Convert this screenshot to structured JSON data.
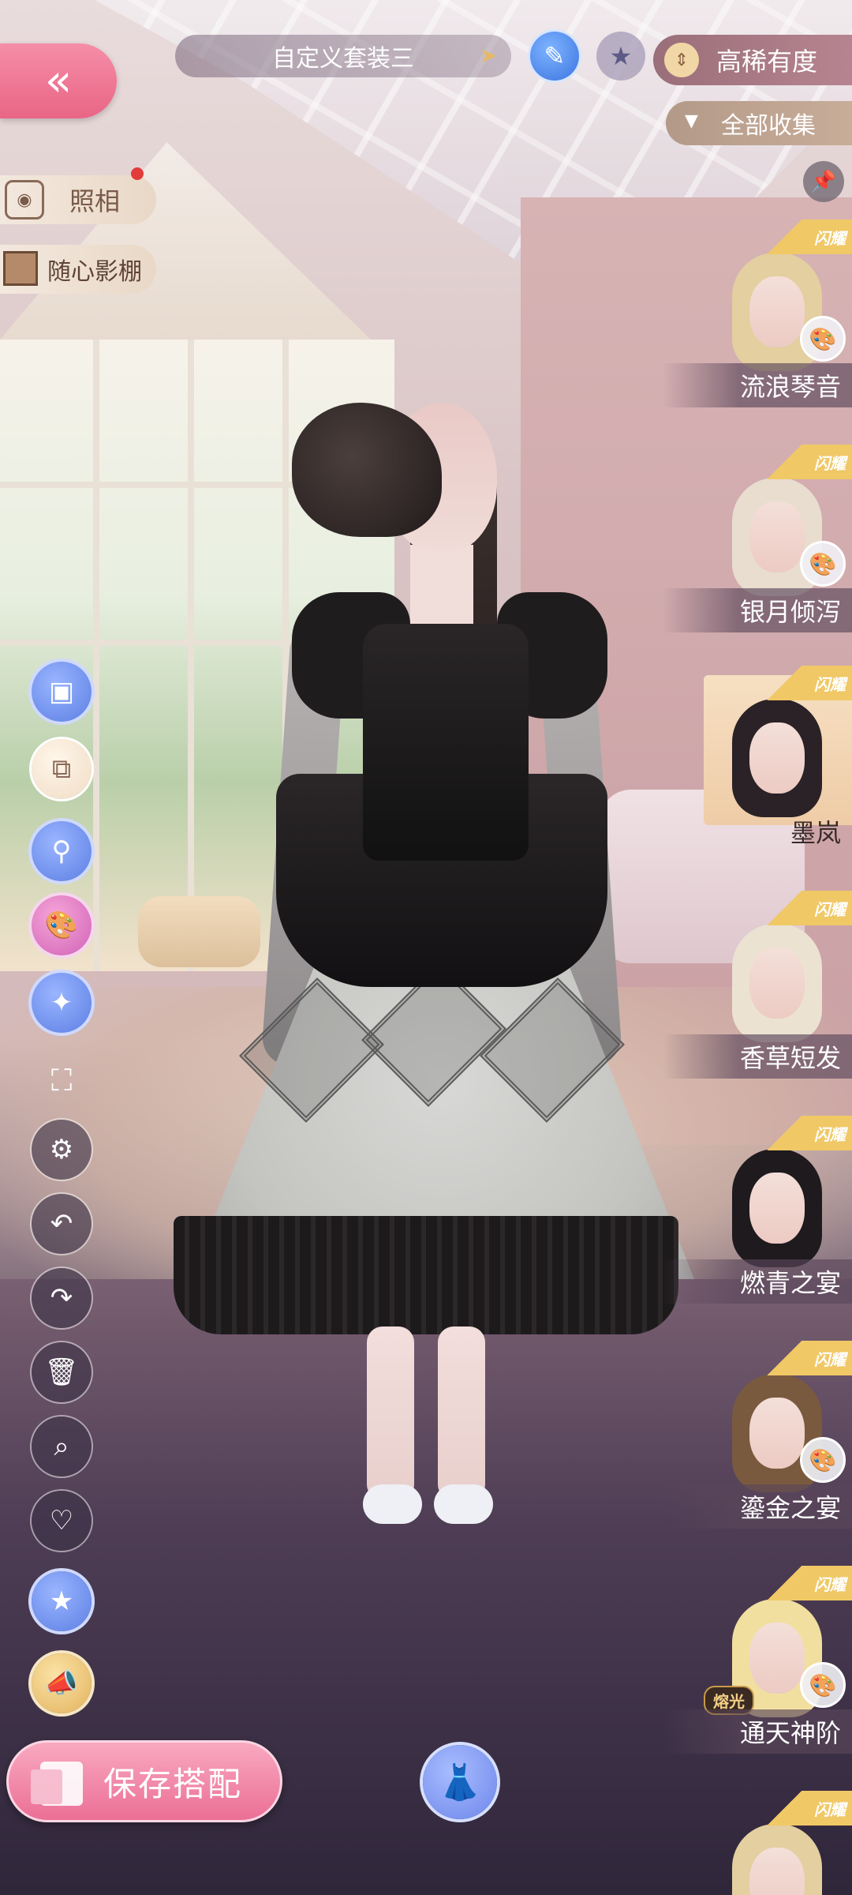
{
  "header": {
    "back_icon": "double-chevron-left-icon",
    "outfit_name": "自定义套装三",
    "rarity_sort_label": "高稀有度",
    "filter_label": "全部收集"
  },
  "left_panel": {
    "photo_label": "照相",
    "studio_label": "随心影棚"
  },
  "bottom": {
    "save_label": "保存搭配"
  },
  "items": [
    {
      "name": "流浪琴音",
      "badge": "闪耀",
      "hair_color": "#e3cf9f",
      "has_paint": true,
      "selected": false
    },
    {
      "name": "银月倾泻",
      "badge": "闪耀",
      "hair_color": "#e8ddcf",
      "has_paint": true,
      "selected": false
    },
    {
      "name": "墨岚",
      "badge": "闪耀",
      "hair_color": "#2a2226",
      "has_paint": false,
      "selected": true
    },
    {
      "name": "香草短发",
      "badge": "闪耀",
      "hair_color": "#ece2d2",
      "has_paint": false,
      "selected": false
    },
    {
      "name": "燃青之宴",
      "badge": "闪耀",
      "hair_color": "#1e1a1e",
      "has_paint": false,
      "selected": false
    },
    {
      "name": "鎏金之宴",
      "badge": "闪耀",
      "hair_color": "#7a5a3e",
      "has_paint": true,
      "selected": false
    },
    {
      "name": "通天神阶",
      "badge": "闪耀",
      "hair_color": "#f1dfa0",
      "has_paint": true,
      "selected": false,
      "tag": "熔光"
    },
    {
      "name": "",
      "badge": "闪耀",
      "hair_color": "#e4cfa0",
      "has_paint": false,
      "selected": false
    }
  ],
  "colors": {
    "accent_pink": "#eb6f96",
    "accent_blue": "#5c7fe3",
    "badge_gold": "#f0c866"
  }
}
